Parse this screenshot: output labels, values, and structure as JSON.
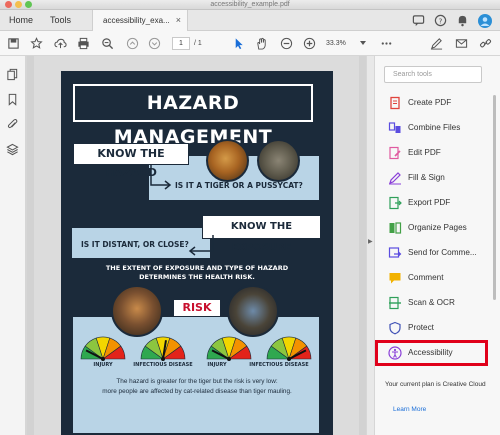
{
  "window": {
    "title": "accessibility_example.pdf"
  },
  "tabs": {
    "home": "Home",
    "tools": "Tools",
    "doc_tab": "accessibility_exa...",
    "close": "×"
  },
  "toolbar": {
    "page_current": "1",
    "page_total": "/ 1",
    "zoom": "33.3%"
  },
  "poster": {
    "title": "HAZARD MANAGEMENT",
    "know_hazard": "KNOW THE HAZARD",
    "hazard_question": "IS IT A TIGER OR A PUSSYCAT?",
    "know_exposure": "KNOW THE EXPOSURE",
    "exposure_question": "IS IT DISTANT, OR CLOSE?",
    "exposure_text_line1": "THE EXTENT OF EXPOSURE AND TYPE OF HAZARD",
    "exposure_text_line2": "DETERMINES THE HEALTH RISK.",
    "risk_label": "RISK",
    "gauges": [
      {
        "label": "INJURY",
        "level": 0.15
      },
      {
        "label": "INFECTIOUS DISEASE",
        "level": 0.55
      },
      {
        "label": "INJURY",
        "level": 0.15
      },
      {
        "label": "INFECTIOUS DISEASE",
        "level": 0.85
      }
    ],
    "bottom_line1": "The hazard is greater for the tiger but the risk is very low:",
    "bottom_line2": "more people are affected by cat-related disease than tiger mauling."
  },
  "right_panel": {
    "search_placeholder": "Search tools",
    "tools": [
      {
        "label": "Create PDF",
        "icon": "create-pdf-icon",
        "color": "#e0443e"
      },
      {
        "label": "Combine Files",
        "icon": "combine-files-icon",
        "color": "#5b4de0"
      },
      {
        "label": "Edit PDF",
        "icon": "edit-pdf-icon",
        "color": "#e05aa0"
      },
      {
        "label": "Fill & Sign",
        "icon": "fill-sign-icon",
        "color": "#8a3fd8"
      },
      {
        "label": "Export PDF",
        "icon": "export-pdf-icon",
        "color": "#2fa05a"
      },
      {
        "label": "Organize Pages",
        "icon": "organize-pages-icon",
        "color": "#43a047"
      },
      {
        "label": "Send for Comme...",
        "icon": "send-comment-icon",
        "color": "#5b4de0"
      },
      {
        "label": "Comment",
        "icon": "comment-icon",
        "color": "#f2b200"
      },
      {
        "label": "Scan & OCR",
        "icon": "scan-ocr-icon",
        "color": "#2fa05a"
      },
      {
        "label": "Protect",
        "icon": "protect-icon",
        "color": "#3f51b5"
      },
      {
        "label": "Accessibility",
        "icon": "accessibility-icon",
        "color": "#8a3fd8"
      }
    ],
    "plan_text": "Your current plan is Creative Cloud",
    "learn_more": "Learn More"
  },
  "colors": {
    "poster_bg": "#1b2a3a",
    "poster_light": "#b9d4e6",
    "risk_red": "#c8102e",
    "highlight": "#e0001a",
    "link_blue": "#1a6ed8"
  }
}
